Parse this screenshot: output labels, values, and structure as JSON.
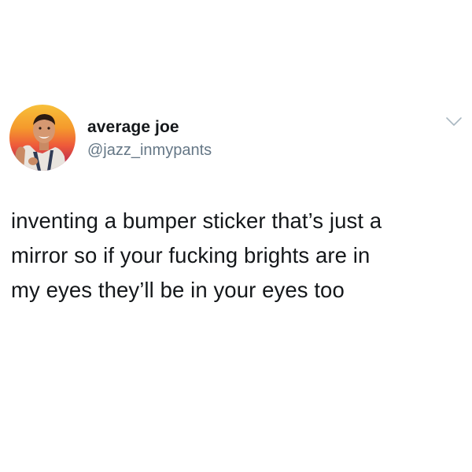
{
  "tweet": {
    "author": {
      "display_name": "average joe",
      "handle": "@jazz_inmypants",
      "avatar_icon": "profile-photo"
    },
    "menu_icon": "chevron-down-icon",
    "text": "inventing a bumper sticker that’s just a\nmirror so if your fucking brights are in\nmy eyes they’ll be in your eyes too"
  },
  "colors": {
    "text_primary": "#14171a",
    "text_secondary": "#657786",
    "chevron": "#aab8c2",
    "background": "#ffffff"
  }
}
